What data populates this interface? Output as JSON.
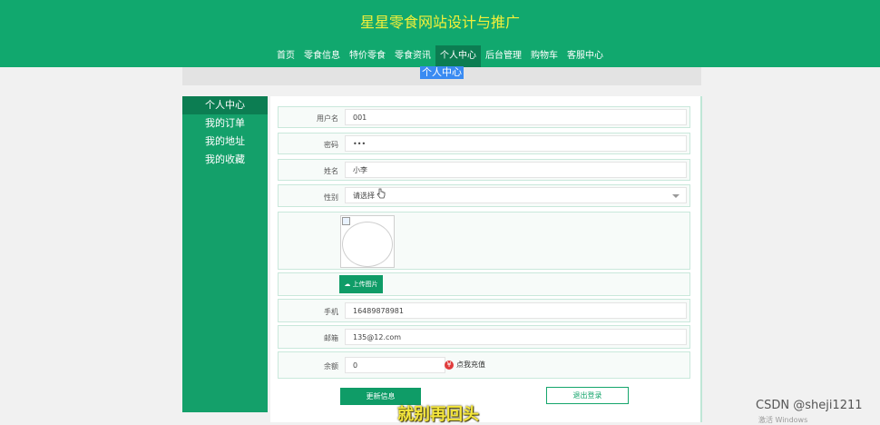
{
  "header": {
    "title": "星星零食网站设计与推广"
  },
  "nav": {
    "items": [
      {
        "label": "首页"
      },
      {
        "label": "零食信息"
      },
      {
        "label": "特价零食"
      },
      {
        "label": "零食资讯"
      },
      {
        "label": "个人中心"
      },
      {
        "label": "后台管理"
      },
      {
        "label": "购物车"
      },
      {
        "label": "客服中心"
      }
    ],
    "active": "个人中心"
  },
  "page": {
    "title": "个人中心"
  },
  "sidebar": {
    "items": [
      {
        "label": "个人中心"
      },
      {
        "label": "我的订单"
      },
      {
        "label": "我的地址"
      },
      {
        "label": "我的收藏"
      }
    ]
  },
  "form": {
    "username": {
      "label": "用户名",
      "value": "001"
    },
    "password": {
      "label": "密码",
      "value": "•••"
    },
    "name": {
      "label": "姓名",
      "value": "小李"
    },
    "gender": {
      "label": "性别",
      "value": "请选择"
    },
    "upload_label": "上传图片",
    "phone": {
      "label": "手机",
      "value": "16489878981"
    },
    "email": {
      "label": "邮箱",
      "value": "135@12.com"
    },
    "balance": {
      "label": "余额",
      "value": "0"
    },
    "recharge_label": "点我充值",
    "update_button": "更新信息",
    "logout_button": "退出登录"
  },
  "overlay": {
    "subtitle": "就别再回头",
    "watermark": "CSDN @sheji1211",
    "activate_text": "激活 Windows"
  },
  "colors": {
    "brand": "#11a86e",
    "active": "#0c7d52",
    "title_text": "#f3f03a"
  }
}
